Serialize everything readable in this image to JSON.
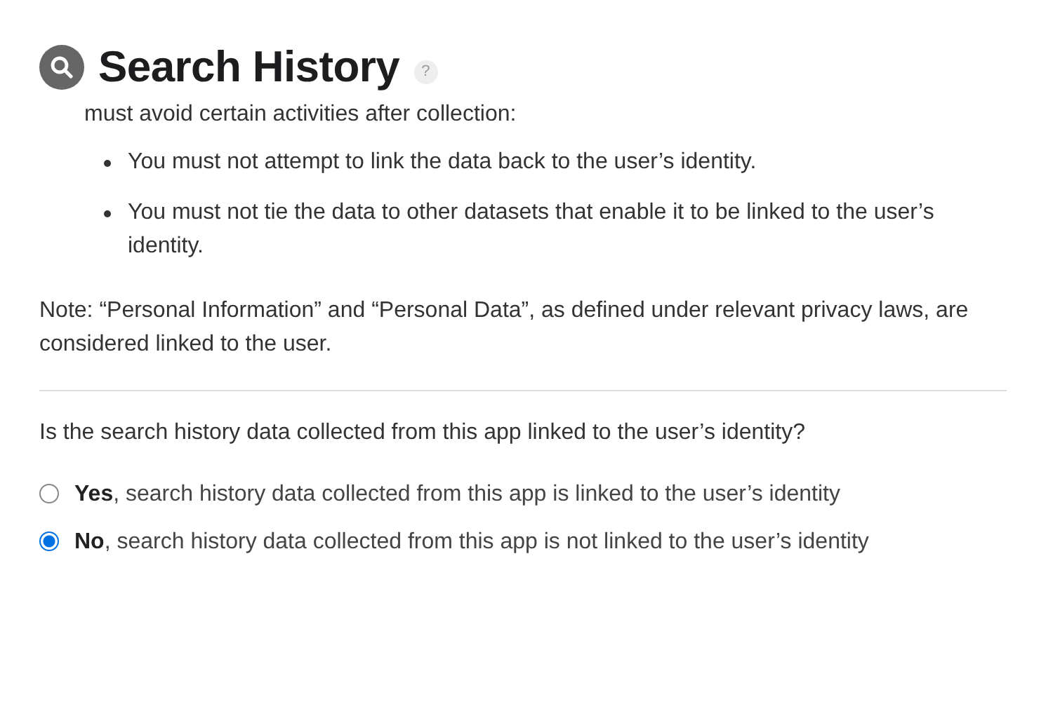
{
  "header": {
    "title": "Search History",
    "help": "?"
  },
  "intro": "must avoid certain activities after collection:",
  "bullets": [
    "You must not attempt to link the data back to the user’s identity.",
    "You must not tie the data to other datasets that enable it to be linked to the user’s identity."
  ],
  "note": "Note: “Personal Information” and “Personal Data”, as defined under relevant privacy laws, are considered linked to the user.",
  "question": "Is the search history data collected from this app linked to the user’s identity?",
  "options": [
    {
      "label": "**Yes**, search history data collected from this app is linked to the user’s identity",
      "selected": false
    },
    {
      "label": "**No**, search history data collected from this app is not linked to the user’s identity",
      "selected": true
    }
  ]
}
